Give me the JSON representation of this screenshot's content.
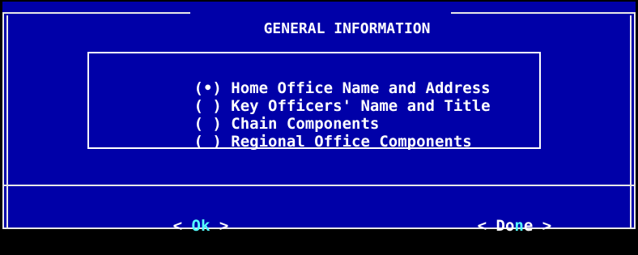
{
  "dialog": {
    "title": "GENERAL INFORMATION",
    "colors": {
      "background": "#0000a8",
      "text": "#ffffff",
      "hotkey": "#55ffff",
      "frame": "#e8e8e8"
    }
  },
  "options": [
    {
      "mark": "(•)",
      "label": "Home Office Name and Address",
      "selected": true
    },
    {
      "mark": "( )",
      "label": "Key Officers' Name and Title",
      "selected": false
    },
    {
      "mark": "( )",
      "label": "Chain Components",
      "selected": false
    },
    {
      "mark": "( )",
      "label": "Regional Office Components",
      "selected": false
    }
  ],
  "buttons": {
    "ok": {
      "left": "< ",
      "hot": "O",
      "rest": "k",
      "right": " >"
    },
    "done": {
      "left": "< ",
      "pre": "Do",
      "hot": "n",
      "rest": "e",
      "right": " >"
    }
  }
}
